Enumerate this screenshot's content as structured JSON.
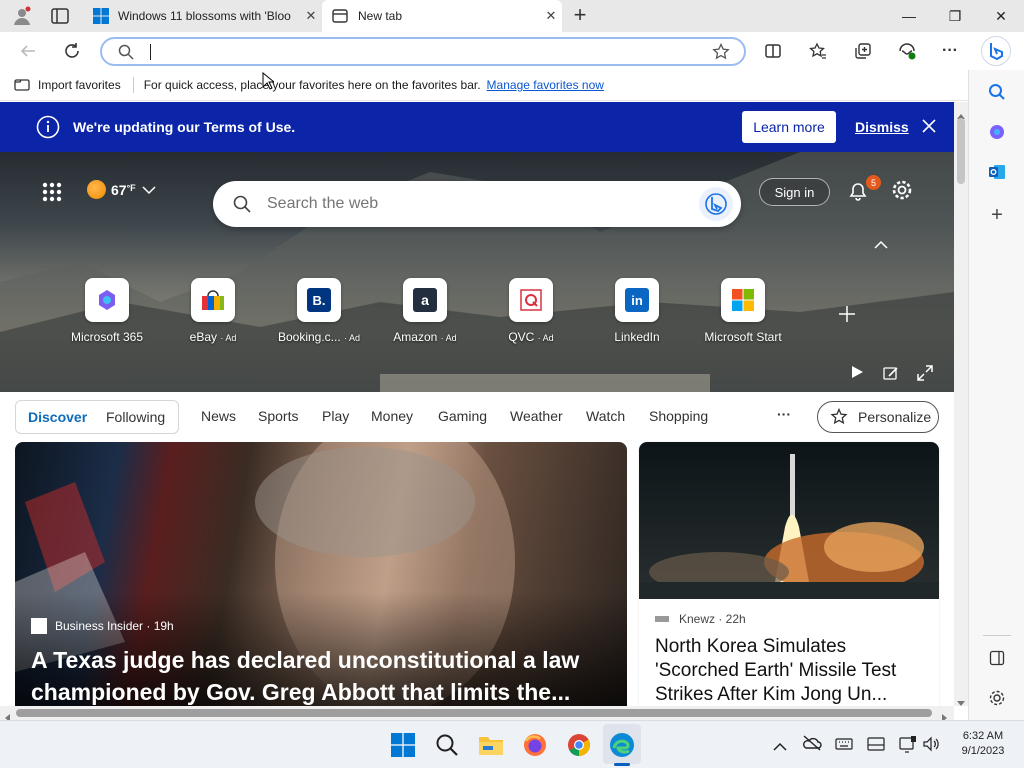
{
  "tabs": [
    {
      "title": "Windows 11 blossoms with 'Bloo",
      "close": "✕"
    },
    {
      "title": "New tab",
      "close": "✕"
    }
  ],
  "new_tab_button": "+",
  "window_controls": {
    "minimize": "—",
    "restore": "❐",
    "close": "✕"
  },
  "favorites_bar": {
    "import_label": "Import favorites",
    "message": "For quick access, place your favorites here on the favorites bar.",
    "link": "Manage favorites now"
  },
  "notice": {
    "text": "We're updating our Terms of Use.",
    "learn_more": "Learn more",
    "dismiss": "Dismiss"
  },
  "weather": {
    "temp": "67",
    "unit": "°F"
  },
  "search": {
    "placeholder": "Search the web"
  },
  "signin": "Sign in",
  "notifications_count": "5",
  "quick_links": [
    {
      "label": "Microsoft 365",
      "ad": ""
    },
    {
      "label": "eBay",
      "ad": "· Ad"
    },
    {
      "label": "Booking.c...",
      "ad": "· Ad"
    },
    {
      "label": "Amazon",
      "ad": "· Ad"
    },
    {
      "label": "QVC",
      "ad": "· Ad"
    },
    {
      "label": "LinkedIn",
      "ad": ""
    },
    {
      "label": "Microsoft Start",
      "ad": ""
    }
  ],
  "feed_tabs": [
    "Discover",
    "Following"
  ],
  "feed_nav": [
    "News",
    "Sports",
    "Play",
    "Money",
    "Gaming",
    "Weather",
    "Watch",
    "Shopping"
  ],
  "more": "···",
  "personalize": "Personalize",
  "main_story": {
    "source": "Business Insider · 19h",
    "headline": "A Texas judge has declared unconstitutional a law championed by Gov. Greg Abbott that limits the..."
  },
  "side_story": {
    "source": "Knewz · 22h",
    "headline": "North Korea Simulates 'Scorched Earth' Missile Test Strikes After Kim Jong Un..."
  },
  "clock": {
    "time": "6:32 AM",
    "date": "9/1/2023"
  },
  "colors": {
    "accent": "#0b24a8",
    "link": "#0b57d0",
    "discover": "#0f6cbd"
  }
}
